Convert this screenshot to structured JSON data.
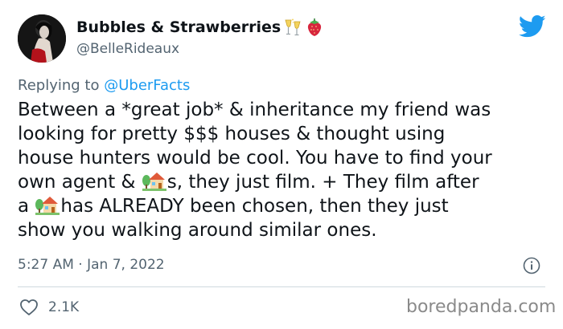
{
  "author": {
    "display_name": "Bubbles & Strawberries",
    "name_emojis": [
      "champagne-glasses-icon",
      "strawberry-icon"
    ],
    "handle": "@BelleRideaux"
  },
  "reply": {
    "prefix": "Replying to",
    "mention": "@UberFacts"
  },
  "tweet": {
    "line1": "Between a *great job* & inheritance my friend was",
    "line2": "looking for pretty $$$ houses & thought using",
    "line3": "house hunters would be cool. You have to find your",
    "line4a": "own agent & ",
    "line4b": "s, they just film. + They film after",
    "line5a": "a ",
    "line5b": "has ALREADY been chosen, then they just",
    "line6": "show you walking around similar ones.",
    "inline_emoji": "house-with-garden-icon"
  },
  "meta": {
    "timestamp": "5:27 AM · Jan 7, 2022"
  },
  "engagement": {
    "likes": "2.1K"
  },
  "watermark": "boredpanda.com",
  "colors": {
    "twitter_blue": "#1d9bf0",
    "text_primary": "#0f1419",
    "text_secondary": "#536471",
    "divider": "#cfd9de"
  }
}
